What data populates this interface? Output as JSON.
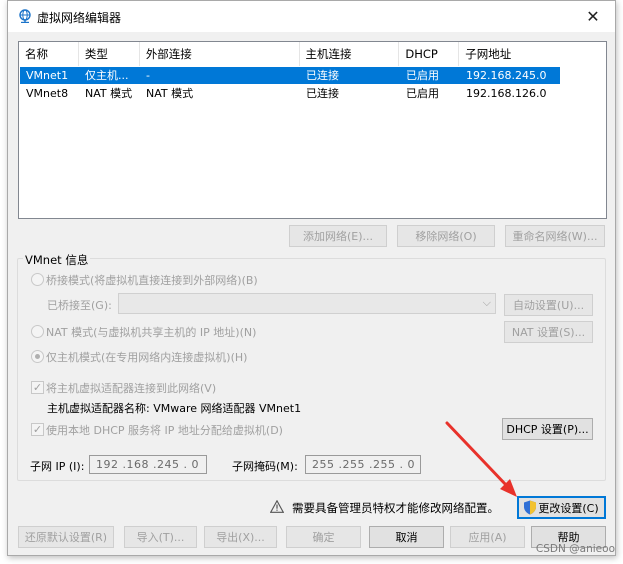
{
  "window": {
    "title": "虚拟网络编辑器",
    "close_glyph": "✕"
  },
  "table": {
    "headers": [
      "名称",
      "类型",
      "外部连接",
      "主机连接",
      "DHCP",
      "子网地址"
    ],
    "rows": [
      [
        "VMnet1",
        "仅主机...",
        "-",
        "已连接",
        "已启用",
        "192.168.245.0"
      ],
      [
        "VMnet8",
        "NAT 模式",
        "NAT 模式",
        "已连接",
        "已启用",
        "192.168.126.0"
      ]
    ],
    "selected_row": 0
  },
  "net_buttons": {
    "add": "添加网络(E)...",
    "remove": "移除网络(O)",
    "rename": "重命名网络(W)..."
  },
  "vmnet_info": {
    "group_label": "VMnet 信息",
    "bridged_label": "桥接模式(将虚拟机直接连接到外部网络)(B)",
    "bridged_to_label": "已桥接至(G):",
    "auto_settings": "自动设置(U)...",
    "nat_label": "NAT 模式(与虚拟机共享主机的 IP 地址)(N)",
    "nat_settings": "NAT 设置(S)...",
    "hostonly_label": "仅主机模式(在专用网络内连接虚拟机)(H)",
    "connect_adapter_label": "将主机虚拟适配器连接到此网络(V)",
    "adapter_name_label": "主机虚拟适配器名称: VMware 网络适配器 VMnet1",
    "use_dhcp_label": "使用本地 DHCP 服务将 IP 地址分配给虚拟机(D)",
    "dhcp_settings": "DHCP 设置(P)...",
    "subnet_ip_label": "子网 IP (I):",
    "subnet_ip_value": "192 .168 .245 . 0",
    "subnet_mask_label": "子网掩码(M):",
    "subnet_mask_value": "255 .255 .255 . 0"
  },
  "admin": {
    "notice": "需要具备管理员特权才能修改网络配置。",
    "change_settings": "更改设置(C)"
  },
  "footer": {
    "restore": "还原默认设置(R)",
    "import": "导入(T)...",
    "export": "导出(X)...",
    "ok": "确定",
    "cancel": "取消",
    "apply": "应用(A)",
    "help": "帮助"
  },
  "watermark": "CSDN @anieoo",
  "colors": {
    "selection": "#0078d7",
    "annotation_arrow": "#e8322b"
  }
}
